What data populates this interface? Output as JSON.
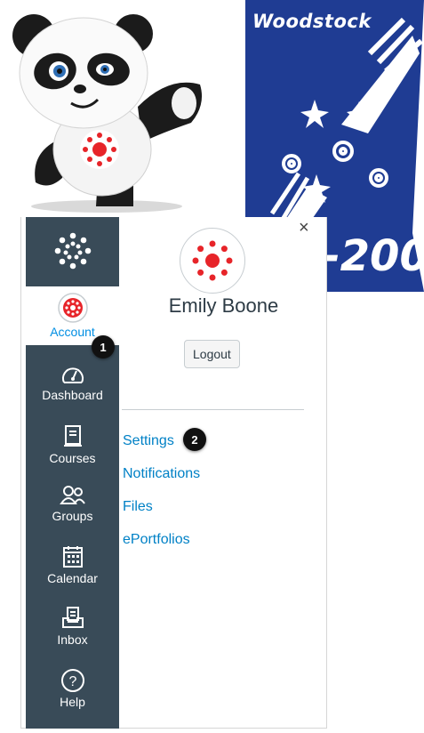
{
  "logo_text": {
    "district_word": "Woodstock",
    "district_code": "D-200"
  },
  "nav": {
    "items": [
      {
        "label": "Account"
      },
      {
        "label": "Dashboard"
      },
      {
        "label": "Courses"
      },
      {
        "label": "Groups"
      },
      {
        "label": "Calendar"
      },
      {
        "label": "Inbox"
      },
      {
        "label": "Help"
      }
    ]
  },
  "tray": {
    "close": "×",
    "user_name": "Emily Boone",
    "logout_label": "Logout",
    "links": [
      "Settings",
      "Notifications",
      "Files",
      "ePortfolios"
    ]
  },
  "callouts": [
    "1",
    "2"
  ],
  "colors": {
    "nav_bg": "#394b58",
    "link": "#0081c6",
    "active_label": "#008ee2",
    "canvas_red": "#e72429",
    "logo_blue": "#1f3c93"
  }
}
